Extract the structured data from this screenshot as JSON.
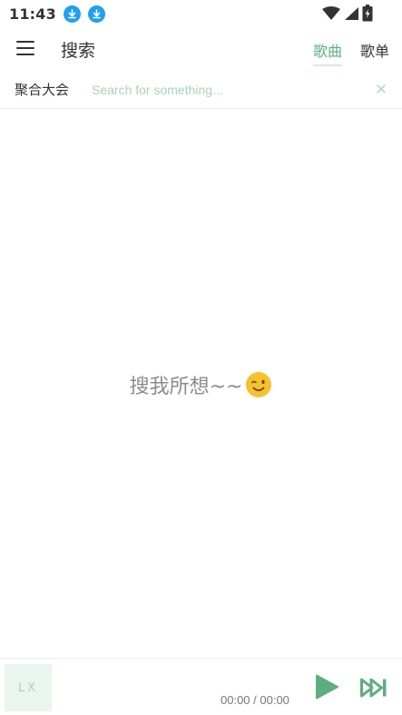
{
  "status_bar": {
    "time": "11:43",
    "icons": [
      "download-icon",
      "download-icon",
      "wifi-icon",
      "signal-icon",
      "battery-charging-icon"
    ]
  },
  "header": {
    "title": "搜索",
    "tabs": [
      {
        "label": "歌曲",
        "active": true
      },
      {
        "label": "歌单",
        "active": false
      }
    ],
    "menu_icon": "hamburger-menu-icon"
  },
  "search": {
    "source": "聚合大会",
    "placeholder": "Search for something...",
    "value": "",
    "clear_icon": "close-icon"
  },
  "empty_state": {
    "text": "搜我所想~~",
    "emoji": "winking-face-icon"
  },
  "player": {
    "cover_text": "LX",
    "time": "00:00 / 00:00",
    "play_icon": "play-icon",
    "next_icon": "skip-next-icon"
  },
  "colors": {
    "accent": "#5dae7e",
    "accent_light": "#a9d4b9",
    "download_badge": "#1ea1f2"
  }
}
